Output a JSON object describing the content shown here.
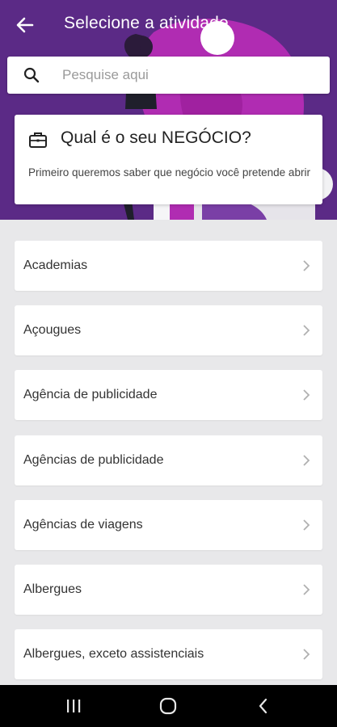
{
  "app": {
    "title": "Selecione a atividade",
    "accent_color": "#5b2a86",
    "illustration_color": "#b52cb4"
  },
  "search": {
    "placeholder": "Pesquise aqui",
    "value": "",
    "icon": "search-icon"
  },
  "business_card": {
    "icon": "briefcase-icon",
    "title": "Qual é o seu NEGÓCIO?",
    "description": "Primeiro queremos saber que negócio você pretende abrir"
  },
  "activities": [
    {
      "label": "Academias"
    },
    {
      "label": "Açougues"
    },
    {
      "label": "Agência de publicidade"
    },
    {
      "label": "Agências de publicidade"
    },
    {
      "label": "Agências de viagens"
    },
    {
      "label": "Albergues"
    },
    {
      "label": "Albergues, exceto assistenciais"
    }
  ],
  "navbar": {
    "buttons": [
      "recent-apps",
      "home",
      "back"
    ]
  }
}
